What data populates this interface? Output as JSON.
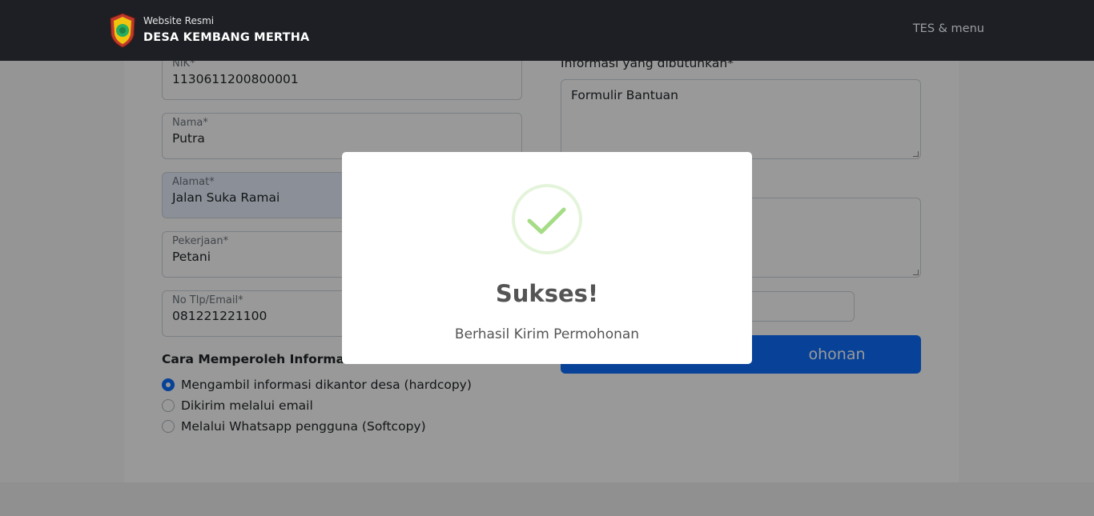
{
  "header": {
    "site_label": "Website Resmi",
    "site_name": "DESA KEMBANG MERTHA",
    "menu_label": "TES & menu"
  },
  "form": {
    "fields": [
      {
        "label": "NIK*",
        "value": "1130611200800001"
      },
      {
        "label": "Nama*",
        "value": "Putra"
      },
      {
        "label": "Alamat*",
        "value": "Jalan Suka Ramai"
      },
      {
        "label": "Pekerjaan*",
        "value": "Petani"
      },
      {
        "label": "No Tlp/Email*",
        "value": "081221221100"
      }
    ],
    "cara_title": "Cara Memperoleh Informasi*",
    "radio_options": [
      {
        "label": "Mengambil informasi dikantor desa (hardcopy)",
        "checked": true
      },
      {
        "label": "Dikirim melalui email",
        "checked": false
      },
      {
        "label": "Melalui Whatsapp pengguna (Softcopy)",
        "checked": false
      }
    ],
    "info_label": "Informasi yang dibutuhkan*",
    "info_value": "Formulir Bantuan",
    "submit_label_visible": "ohonan"
  },
  "modal": {
    "title": "Sukses!",
    "message": "Berhasil Kirim Permohonan",
    "icon": "check-circle-icon",
    "icon_color": "#a5dc86"
  },
  "colors": {
    "navbar": "#1d1f24",
    "primary": "#0d6efd"
  }
}
